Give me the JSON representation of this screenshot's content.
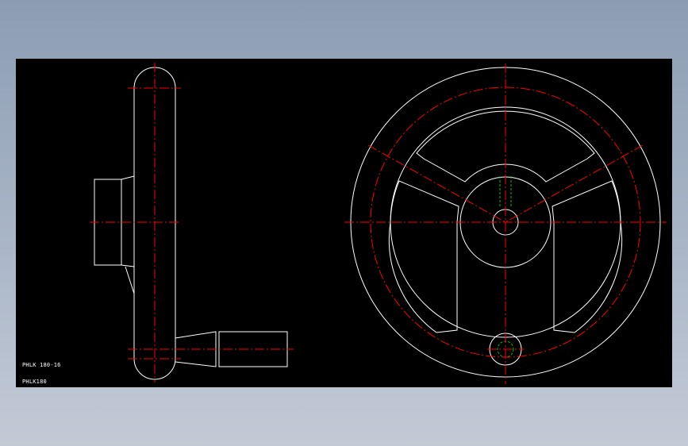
{
  "drawing": {
    "labels": [
      "PHLK 180-16",
      "PHLK180"
    ],
    "colors": {
      "background": "#000000",
      "outline": "#ffffff",
      "centerline": "#ff0000",
      "keyway": "#00c000",
      "frame": "#8c9db2"
    },
    "linetypes": {
      "outline": "continuous",
      "centerline": "dash-dot",
      "keyway": "dashed"
    },
    "views": [
      "side-view",
      "front-view"
    ]
  }
}
